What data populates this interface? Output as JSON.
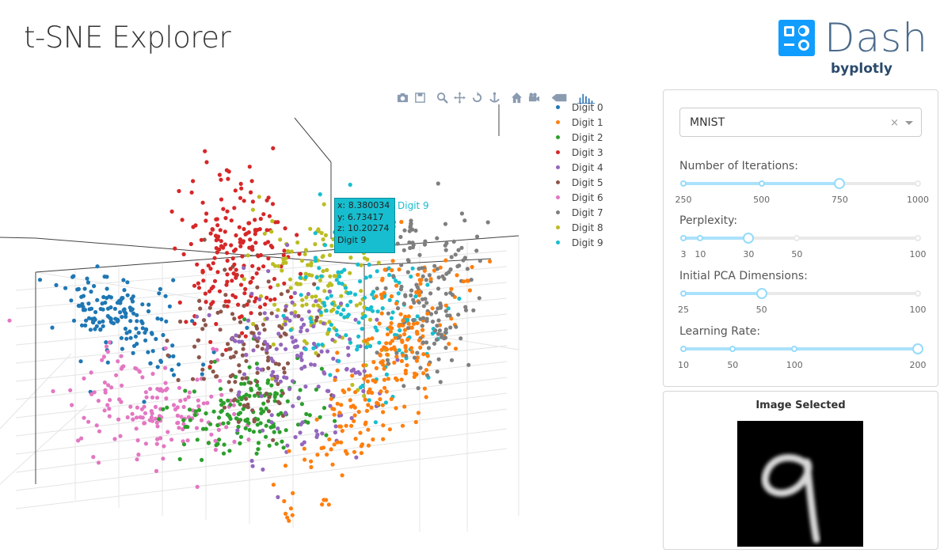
{
  "app": {
    "title": "t-SNE Explorer"
  },
  "logo": {
    "name": "Dash",
    "sub": "byplotly",
    "icon": "dash-logo-icon",
    "brand_color": "#119dff"
  },
  "modebar": {
    "buttons": [
      {
        "name": "camera-icon",
        "title": "Download plot as a png"
      },
      {
        "name": "save-icon",
        "title": "Save and edit plot in cloud"
      },
      {
        "name": "zoom-icon",
        "title": "Zoom"
      },
      {
        "name": "pan-icon",
        "title": "Pan"
      },
      {
        "name": "orbit-rotation-icon",
        "title": "Orbital rotation"
      },
      {
        "name": "turntable-icon",
        "title": "Turntable rotation"
      },
      {
        "name": "home-icon",
        "title": "Reset camera to default"
      },
      {
        "name": "camera-last-save-icon",
        "title": "Reset camera to last save"
      },
      {
        "name": "toggle-hover-icon",
        "title": "Toggle show closest data on hover"
      },
      {
        "name": "plotly-logo-icon",
        "title": "Produced with Plotly"
      }
    ]
  },
  "legend": {
    "items": [
      {
        "label": "Digit 0",
        "color": "#1f77b4"
      },
      {
        "label": "Digit 1",
        "color": "#ff7f0e"
      },
      {
        "label": "Digit 2",
        "color": "#2ca02c"
      },
      {
        "label": "Digit 3",
        "color": "#d62728"
      },
      {
        "label": "Digit 4",
        "color": "#9467bd"
      },
      {
        "label": "Digit 5",
        "color": "#8c564b"
      },
      {
        "label": "Digit 6",
        "color": "#e377c2"
      },
      {
        "label": "Digit 7",
        "color": "#7f7f7f"
      },
      {
        "label": "Digit 8",
        "color": "#bcbd22"
      },
      {
        "label": "Digit 9",
        "color": "#17becf"
      }
    ]
  },
  "hover": {
    "x": "x: 8.380034",
    "y": "y: 6.73417",
    "z": "z: 10.20274",
    "name": "Digit 9",
    "label": "Digit 9"
  },
  "controls": {
    "dataset": {
      "value": "MNIST",
      "clear": "×"
    },
    "sliders": [
      {
        "label": "Number of Iterations:",
        "min": 250,
        "max": 1000,
        "value": 750,
        "marks": [
          {
            "v": 250,
            "t": "250"
          },
          {
            "v": 500,
            "t": "500"
          },
          {
            "v": 750,
            "t": "750"
          },
          {
            "v": 1000,
            "t": "1000"
          }
        ]
      },
      {
        "label": "Perplexity:",
        "min": 3,
        "max": 100,
        "value": 30,
        "marks": [
          {
            "v": 3,
            "t": "3"
          },
          {
            "v": 10,
            "t": "10"
          },
          {
            "v": 30,
            "t": "30"
          },
          {
            "v": 50,
            "t": "50"
          },
          {
            "v": 100,
            "t": "100"
          }
        ]
      },
      {
        "label": "Initial PCA Dimensions:",
        "min": 25,
        "max": 100,
        "value": 50,
        "marks": [
          {
            "v": 25,
            "t": "25"
          },
          {
            "v": 50,
            "t": "50"
          },
          {
            "v": 100,
            "t": "100"
          }
        ]
      },
      {
        "label": "Learning Rate:",
        "min": 10,
        "max": 200,
        "value": 200,
        "marks": [
          {
            "v": 10,
            "t": "10"
          },
          {
            "v": 50,
            "t": "50"
          },
          {
            "v": 100,
            "t": "100"
          },
          {
            "v": 200,
            "t": "200"
          }
        ]
      }
    ]
  },
  "image_panel": {
    "title": "Image Selected",
    "digit": "9"
  }
}
